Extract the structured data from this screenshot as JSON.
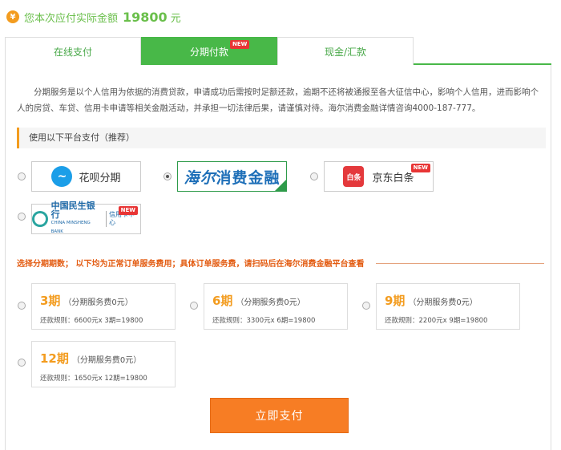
{
  "header": {
    "yen_symbol": "¥",
    "amount_label": "您本次应付实际金额",
    "amount_value": "19800",
    "amount_unit": "元"
  },
  "tabs": [
    {
      "label": "在线支付",
      "active": false
    },
    {
      "label": "分期付款",
      "active": true,
      "badge": "NEW"
    },
    {
      "label": "现金/汇款",
      "active": false
    }
  ],
  "notice": "分期服务是以个人信用为依据的消费贷款，申请成功后需按时足额还款，逾期不还将被通报至各大征信中心，影响个人信用，进而影响个人的房贷、车贷、信用卡申请等相关金融活动，并承担一切法律后果，请谨慎对待。海尔消费金融详情咨询4000-187-777。",
  "platform_section": {
    "title": "使用以下平台支付（推荐）",
    "platforms": [
      {
        "name": "花呗分期",
        "logo_text": "~",
        "selected": false
      },
      {
        "name": "海尔消费金融",
        "logo_script": "海尔",
        "selected": true
      },
      {
        "name": "京东白条",
        "logo_text": "白条",
        "badge": "NEW",
        "selected": false
      },
      {
        "name_cn": "中国民生银行",
        "name_en": "CHINA MINSHENG BANK",
        "sub": "信用卡中心",
        "badge": "NEW",
        "selected": false
      }
    ]
  },
  "period_section": {
    "title": "选择分期期数；  以下均为正常订单服务费用；具体订单服务费，请扫码后在海尔消费金融平台查看",
    "plans": [
      {
        "period": "3期",
        "fee": "（分期服务费0元）",
        "rule": "还款规则：6600元x 3期=19800"
      },
      {
        "period": "6期",
        "fee": "（分期服务费0元）",
        "rule": "还款规则：3300元x 6期=19800"
      },
      {
        "period": "9期",
        "fee": "（分期服务费0元）",
        "rule": "还款规则：2200元x 9期=19800"
      },
      {
        "period": "12期",
        "fee": "（分期服务费0元）",
        "rule": "还款规则：1650元x 12期=19800"
      }
    ]
  },
  "pay_button": "立即支付",
  "colors": {
    "brand_green": "#48b848",
    "accent_orange": "#f39c1f",
    "button_orange": "#f77d24",
    "warning_red": "#e35c12"
  }
}
